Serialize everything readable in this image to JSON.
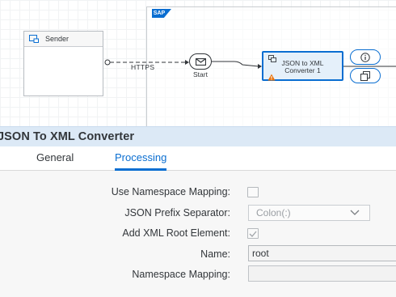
{
  "diagram": {
    "sap_logo": "SAP",
    "sender_label": "Sender",
    "connection_label": "HTTPS",
    "start_label": "Start",
    "step_title_line1": "JSON to XML",
    "step_title_line2": "Converter 1",
    "icons": [
      "participant-icon",
      "mail-icon",
      "converter-icon",
      "warning-icon",
      "info-icon",
      "copy-icon"
    ]
  },
  "panel": {
    "title": "JSON To XML Converter",
    "tabs": [
      {
        "label": "General",
        "selected": false
      },
      {
        "label": "Processing",
        "selected": true
      }
    ],
    "fields": {
      "use_namespace_mapping": {
        "label": "Use Namespace Mapping:",
        "checked": false
      },
      "json_prefix_separator": {
        "label": "JSON Prefix Separator:",
        "value": "Colon(:)"
      },
      "add_xml_root_element": {
        "label": "Add XML Root Element:",
        "checked": true
      },
      "name": {
        "label": "Name:",
        "value": "root"
      },
      "namespace_mapping": {
        "label": "Namespace Mapping:",
        "value": ""
      }
    }
  },
  "colors": {
    "accent": "#0a6ed1",
    "header_bg": "#dce9f6",
    "form_bg": "#f7f7f7",
    "warning": "#e9730c"
  }
}
